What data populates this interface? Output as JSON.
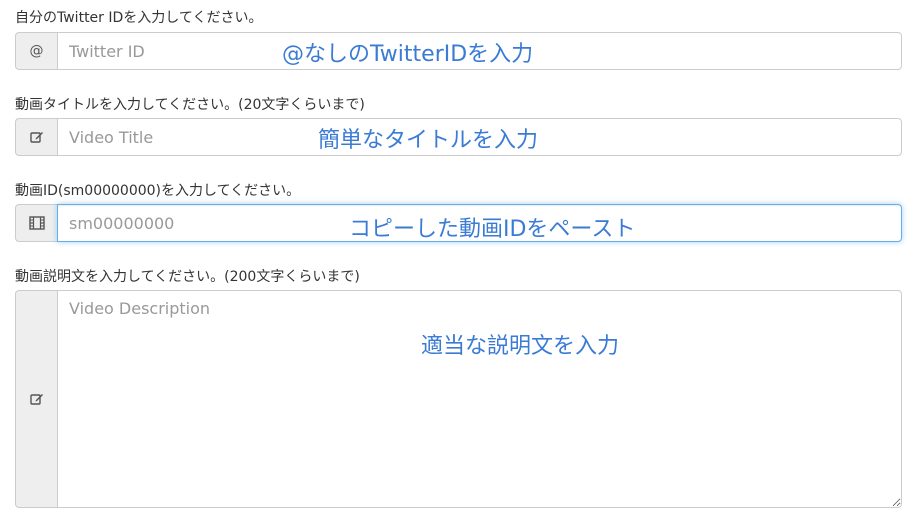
{
  "fields": [
    {
      "label": "自分のTwitter IDを入力してください。",
      "addon_icon": "at-sign-icon",
      "addon_text": "@",
      "placeholder": "Twitter ID",
      "value": "",
      "annotation": "@なしのTwitterIDを入力"
    },
    {
      "label": "動画タイトルを入力してください。(20文字くらいまで)",
      "addon_icon": "edit-icon",
      "placeholder": "Video Title",
      "value": "",
      "annotation": "簡単なタイトルを入力"
    },
    {
      "label": "動画ID(sm00000000)を入力してください。",
      "addon_icon": "film-icon",
      "placeholder": "sm00000000",
      "value": "",
      "annotation": "コピーした動画IDをペースト"
    },
    {
      "label": "動画説明文を入力してください。(200文字くらいまで)",
      "addon_icon": "edit-icon",
      "placeholder": "Video Description",
      "value": "",
      "annotation": "適当な説明文を入力"
    }
  ],
  "colors": {
    "annotation": "#3a7bd5",
    "focus_border": "#66afe9",
    "addon_bg": "#eeeeee"
  }
}
